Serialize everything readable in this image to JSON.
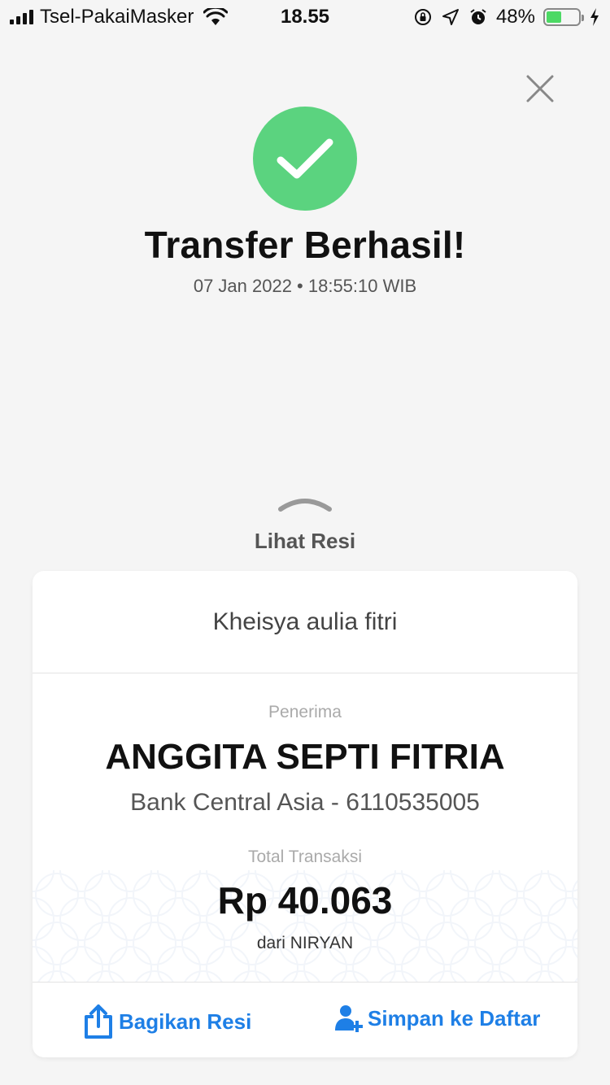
{
  "status_bar": {
    "carrier": "Tsel-PakaiMasker",
    "time": "18.55",
    "battery_percent": "48%",
    "battery_level": 0.48
  },
  "result": {
    "title": "Transfer Berhasil!",
    "datetime": "07 Jan 2022 • 18:55:10 WIB"
  },
  "receipt_toggle": {
    "label": "Lihat Resi"
  },
  "card": {
    "sender_header": "Kheisya aulia fitri",
    "recipient_label": "Penerima",
    "recipient_name": "ANGGITA SEPTI FITRIA",
    "recipient_bank": "Bank Central Asia - 6110535005",
    "total_label": "Total Transaksi",
    "amount": "Rp 40.063",
    "from": "dari NIRYAN"
  },
  "actions": {
    "share_label": "Bagikan Resi",
    "save_label": "Simpan ke Daftar"
  },
  "colors": {
    "success": "#5bd37f",
    "accent": "#1e7fe6",
    "background": "#f5f5f5"
  }
}
